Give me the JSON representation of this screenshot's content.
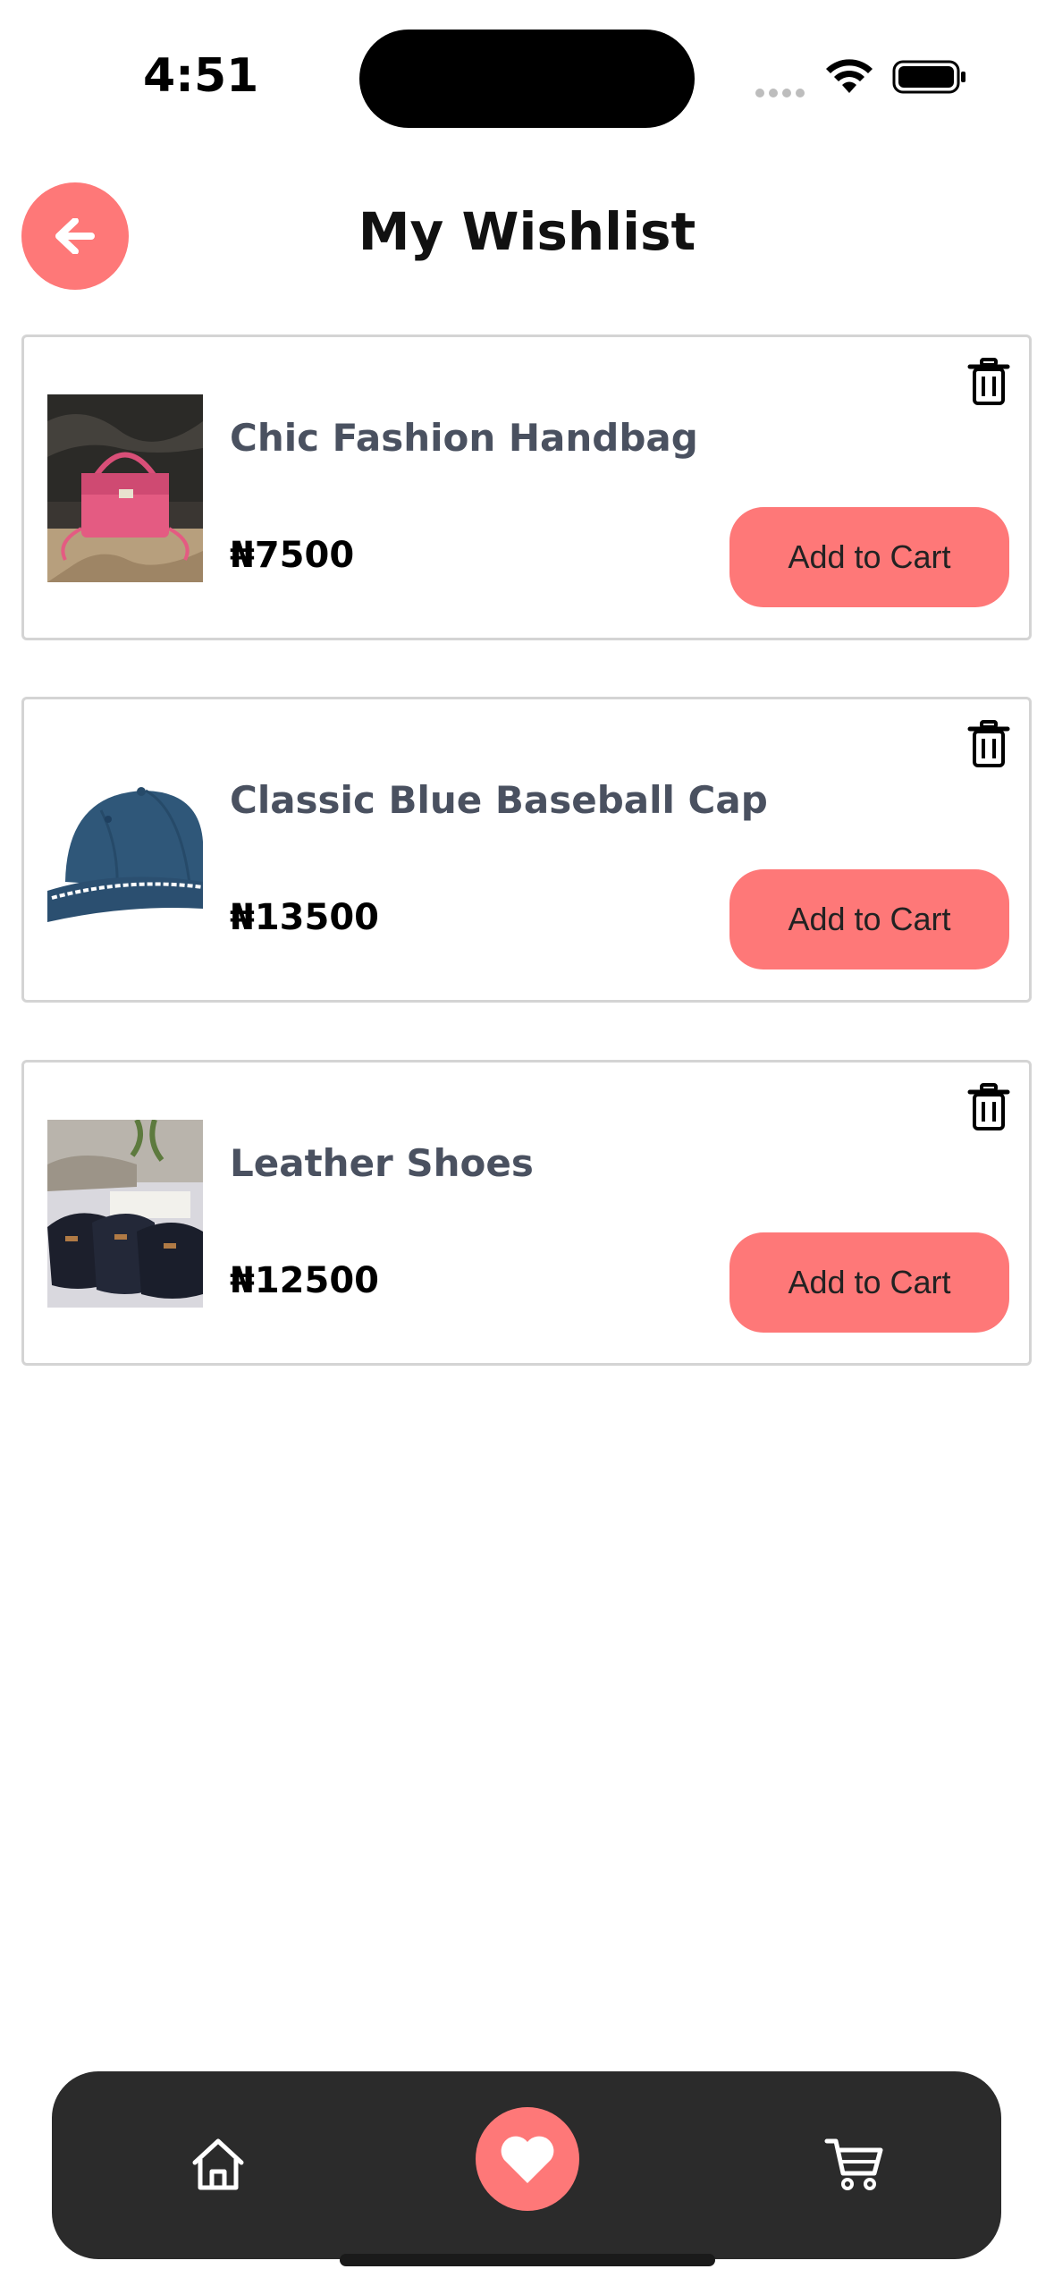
{
  "status_bar": {
    "time": "4:51"
  },
  "header": {
    "title": "My Wishlist",
    "back_icon": "arrow-left-icon"
  },
  "wishlist": {
    "items": [
      {
        "name": "Chic Fashion Handbag",
        "price": "₦7500",
        "button_label": "Add to Cart",
        "image": "pink-handbag"
      },
      {
        "name": "Classic Blue Baseball Cap",
        "price": "₦13500",
        "button_label": "Add to Cart",
        "image": "blue-cap"
      },
      {
        "name": "Leather Shoes",
        "price": "₦12500",
        "button_label": "Add to Cart",
        "image": "shoes"
      }
    ]
  },
  "bottom_nav": {
    "items": [
      {
        "icon": "home-icon",
        "active": false
      },
      {
        "icon": "heart-icon",
        "active": true
      },
      {
        "icon": "cart-icon",
        "active": false
      }
    ]
  },
  "colors": {
    "accent": "#fe7878",
    "nav_background": "#2b2b2b",
    "item_name": "#4a5160"
  }
}
